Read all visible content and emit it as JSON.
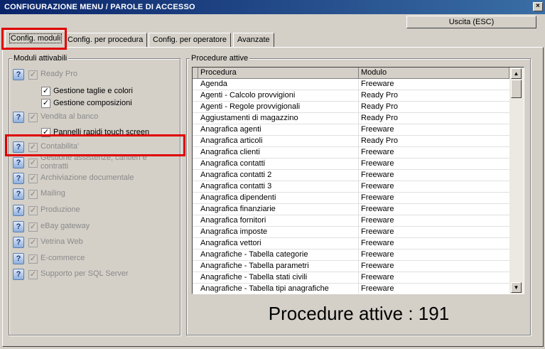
{
  "window": {
    "title": "CONFIGURAZIONE MENU / PAROLE DI ACCESSO",
    "close_glyph": "×"
  },
  "exit_button": "Uscita (ESC)",
  "tabs": [
    "Config. moduli",
    "Config. per procedura",
    "Config. per operatore",
    "Avanzate"
  ],
  "left_group": {
    "title": "Moduli attivabili",
    "help_glyph": "?",
    "check_glyph": "✓",
    "modules": [
      {
        "label": "Ready Pro",
        "sub": [
          "Gestione taglie e colori",
          "Gestione composizioni"
        ]
      },
      {
        "label": "Vendita al banco",
        "sub": [
          "Pannelli rapidi touch screen"
        ]
      },
      {
        "label": "Contabilita'",
        "sub": []
      },
      {
        "label": "Gestione assistenze, cantieri e contratti",
        "sub": []
      },
      {
        "label": "Archiviazione documentale",
        "sub": []
      },
      {
        "label": "Mailing",
        "sub": []
      },
      {
        "label": "Produzione",
        "sub": []
      },
      {
        "label": "eBay gateway",
        "sub": []
      },
      {
        "label": "Vetrina Web",
        "sub": []
      },
      {
        "label": "E-commerce",
        "sub": []
      },
      {
        "label": "Supporto per SQL Server",
        "sub": []
      }
    ]
  },
  "right_group": {
    "title": "Procedure attive",
    "columns": [
      "Procedura",
      "Modulo"
    ],
    "rows": [
      [
        "Agenda",
        "Freeware"
      ],
      [
        "Agenti - Calcolo provvigioni",
        "Ready Pro"
      ],
      [
        "Agenti - Regole provvigionali",
        "Ready Pro"
      ],
      [
        "Aggiustamenti di magazzino",
        "Ready Pro"
      ],
      [
        "Anagrafica agenti",
        "Freeware"
      ],
      [
        "Anagrafica articoli",
        "Ready Pro"
      ],
      [
        "Anagrafica clienti",
        "Freeware"
      ],
      [
        "Anagrafica contatti",
        "Freeware"
      ],
      [
        "Anagrafica contatti 2",
        "Freeware"
      ],
      [
        "Anagrafica contatti 3",
        "Freeware"
      ],
      [
        "Anagrafica dipendenti",
        "Freeware"
      ],
      [
        "Anagrafica finanziarie",
        "Freeware"
      ],
      [
        "Anagrafica fornitori",
        "Freeware"
      ],
      [
        "Anagrafica imposte",
        "Freeware"
      ],
      [
        "Anagrafica vettori",
        "Freeware"
      ],
      [
        "Anagrafiche - Tabella categorie",
        "Freeware"
      ],
      [
        "Anagrafiche - Tabella parametri",
        "Freeware"
      ],
      [
        "Anagrafiche - Tabella stati civili",
        "Freeware"
      ],
      [
        "Anagrafiche - Tabella tipi anagrafiche",
        "Freeware"
      ]
    ],
    "scroll_up": "▲",
    "scroll_down": "▼",
    "count_label": "Procedure attive : 191"
  },
  "colors": {
    "highlight": "#e00000",
    "titlebar": "#0a246a"
  }
}
